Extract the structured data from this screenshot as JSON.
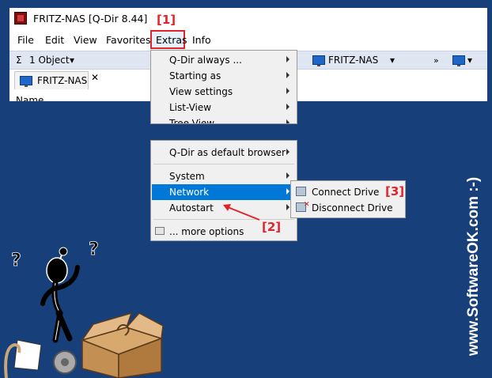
{
  "window": {
    "title": "FRITZ-NAS  [Q-Dir 8.44]"
  },
  "menubar": {
    "items": [
      "File",
      "Edit",
      "View",
      "Favorites",
      "Extras",
      "Info"
    ]
  },
  "toolbar": {
    "objects": "1 Object",
    "location": "FRITZ-NAS"
  },
  "tab": {
    "label": "FRITZ-NAS",
    "column_header": "Name"
  },
  "extras_menu": {
    "group1": [
      "Q-Dir always ...",
      "Starting as",
      "View settings",
      "List-View",
      "Tree-View"
    ],
    "default_browser": "Q-Dir as default browser",
    "system": "System",
    "network": "Network",
    "autostart": "Autostart",
    "more_options": "... more options"
  },
  "network_submenu": {
    "connect": "Connect Drive",
    "disconnect": "Disconnect Drive"
  },
  "annotations": {
    "a1": "[1]",
    "a2": "[2]",
    "a3": "[3]"
  },
  "watermark": "www.SoftwareOK.com :-)",
  "colors": {
    "background": "#173f7a",
    "highlight": "#0078d7",
    "annotation": "#e3232b"
  }
}
